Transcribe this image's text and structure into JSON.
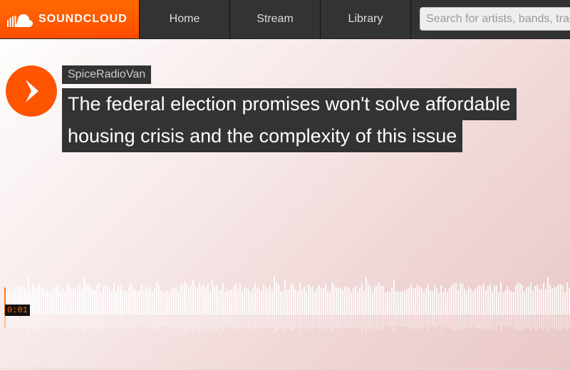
{
  "header": {
    "logo_text": "SOUNDCLOUD",
    "nav": {
      "home": "Home",
      "stream": "Stream",
      "library": "Library"
    },
    "search_placeholder": "Search for artists, bands, tracks, podcasts"
  },
  "track": {
    "artist": "SpiceRadioVan",
    "title_line1": "The federal election promises won't solve affordable",
    "title_line2": "housing crisis and the complexity of this issue",
    "time": "0:01",
    "played_fraction": 0.01
  },
  "colors": {
    "accent": "#ff5500",
    "header_bg": "#333333"
  }
}
